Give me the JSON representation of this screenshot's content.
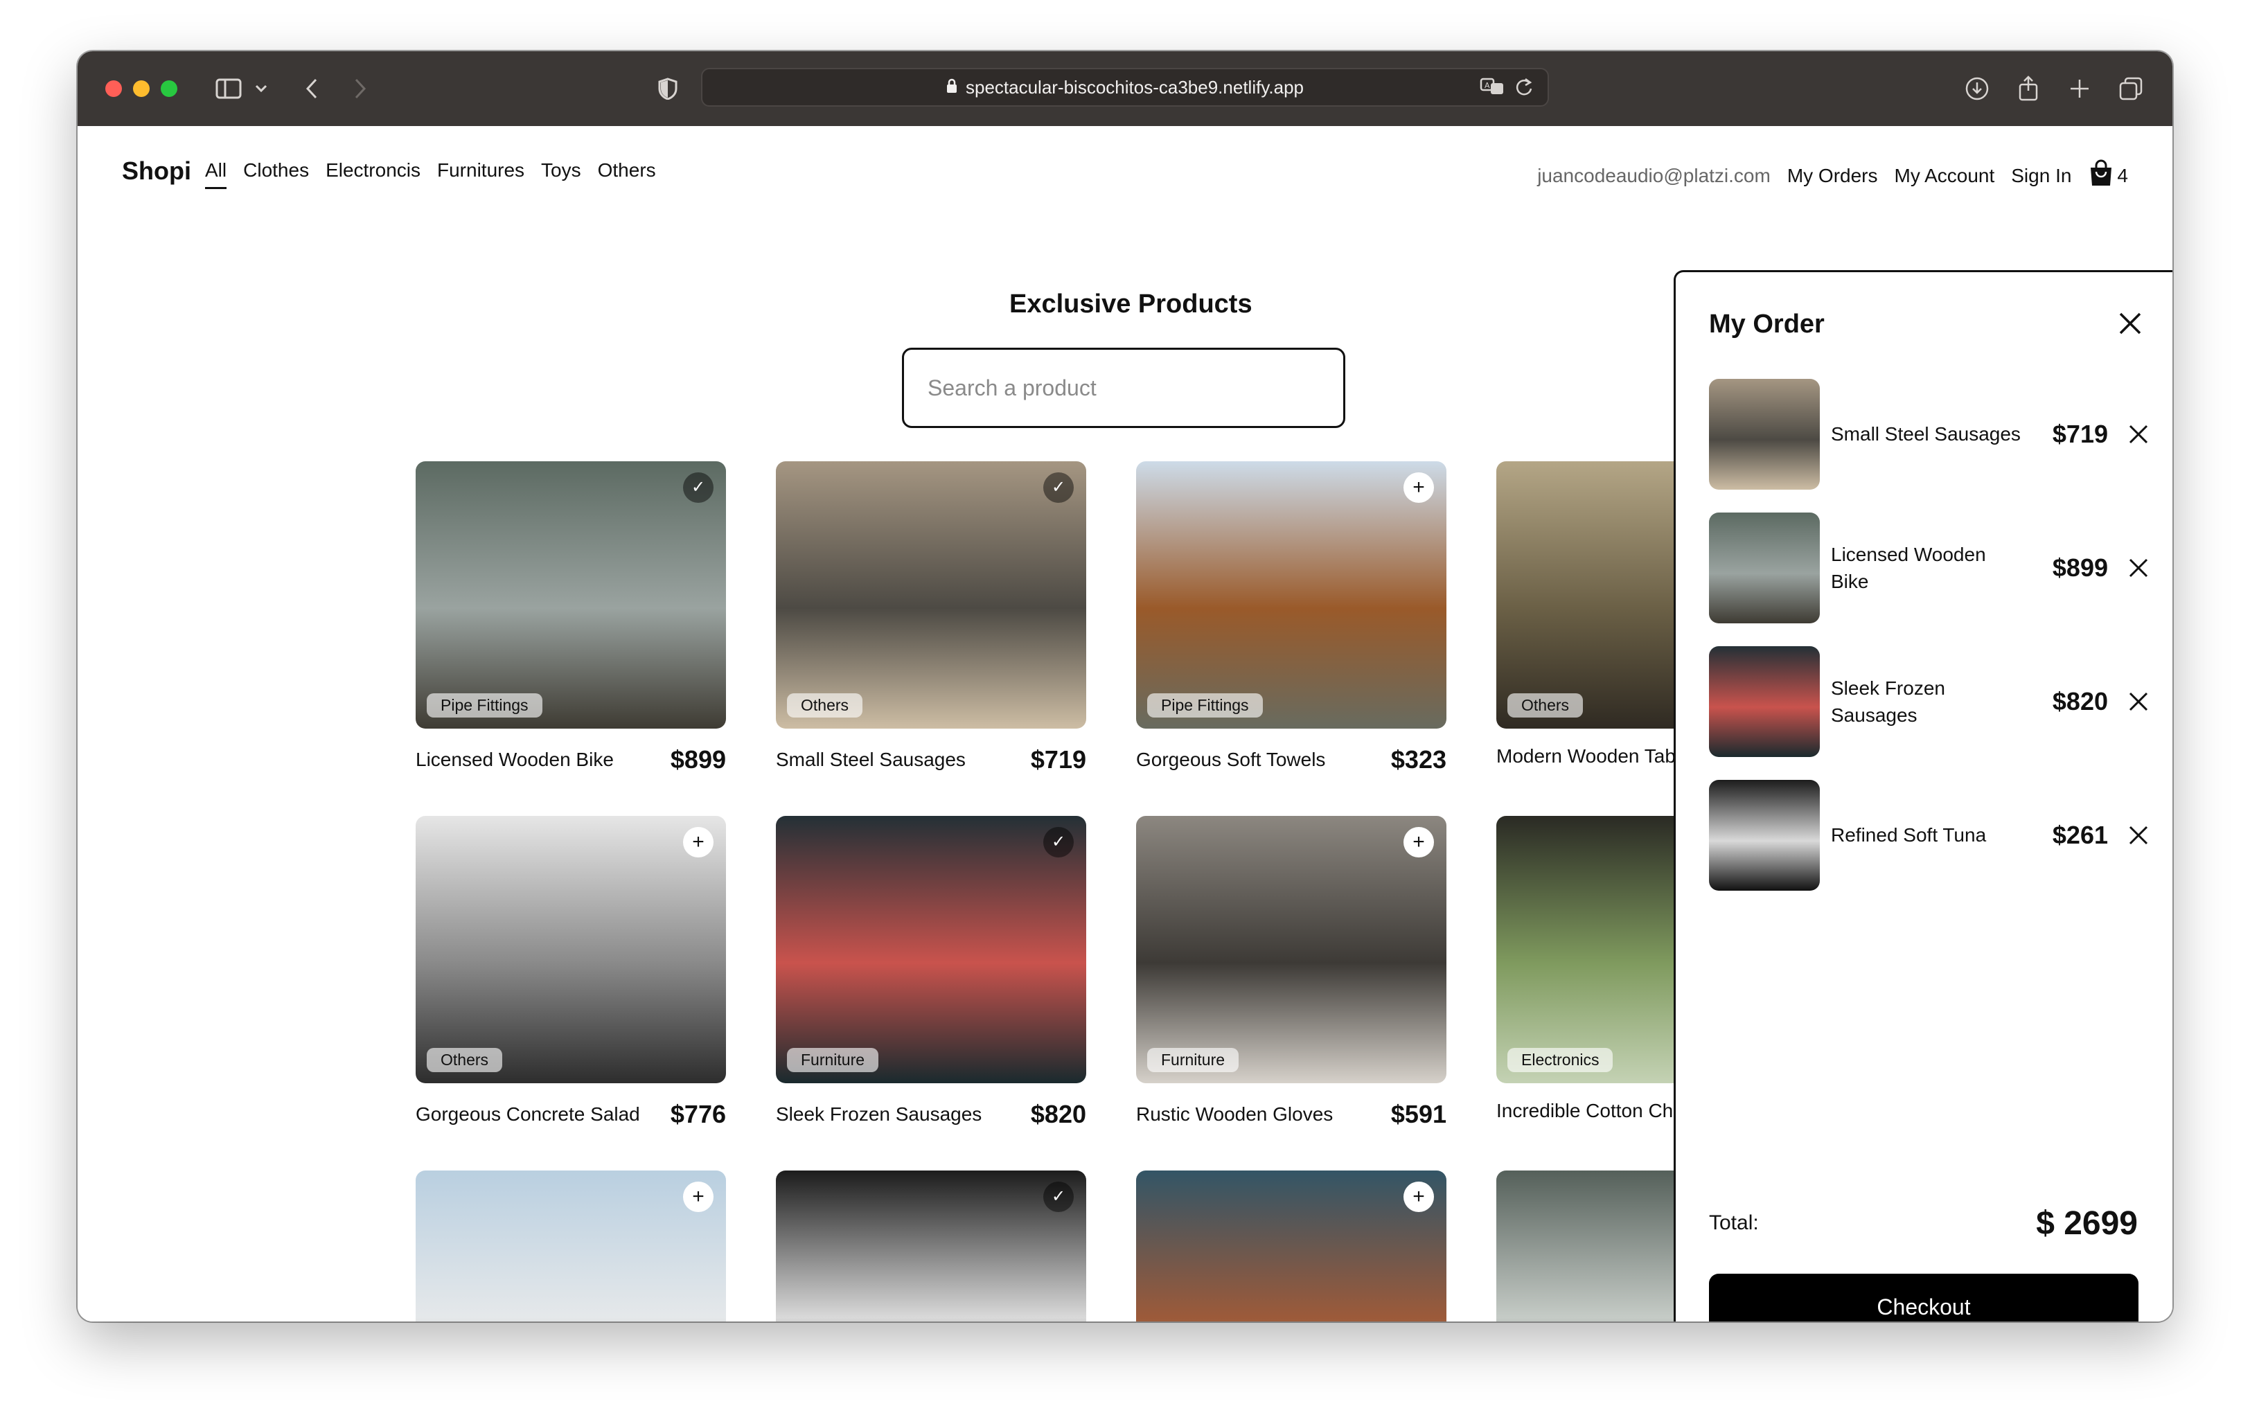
{
  "browser": {
    "url": "spectacular-biscochitos-ca3be9.netlify.app"
  },
  "nav": {
    "brand": "Shopi",
    "categories": [
      "All",
      "Clothes",
      "Electroncis",
      "Furnitures",
      "Toys",
      "Others"
    ],
    "active_category": "All",
    "email": "juancodeaudio@platzi.com",
    "my_orders": "My Orders",
    "my_account": "My Account",
    "sign_in": "Sign In",
    "cart_count": "4"
  },
  "main": {
    "heading": "Exclusive Products",
    "search_placeholder": "Search a product"
  },
  "products": [
    {
      "name": "Licensed Wooden Bike",
      "price": "$899",
      "category": "Pipe Fittings",
      "in_cart": true,
      "palette": [
        "#5c6a62",
        "#9aa3a0",
        "#3e3b33"
      ]
    },
    {
      "name": "Small Steel Sausages",
      "price": "$719",
      "category": "Others",
      "in_cart": true,
      "palette": [
        "#a59682",
        "#4d4a44",
        "#cdbda4"
      ]
    },
    {
      "name": "Gorgeous Soft Towels",
      "price": "$323",
      "category": "Pipe Fittings",
      "in_cart": false,
      "palette": [
        "#cddbe8",
        "#9a5a2a",
        "#686b5f"
      ]
    },
    {
      "name": "Modern Wooden Table",
      "price": "",
      "category": "Others",
      "in_cart": false,
      "palette": [
        "#b4a686",
        "#6b6046",
        "#2f2a22"
      ]
    },
    {
      "name": "Gorgeous Concrete Salad",
      "price": "$776",
      "category": "Others",
      "in_cart": false,
      "palette": [
        "#e6e6e6",
        "#8a8a8a",
        "#2d2d2d"
      ]
    },
    {
      "name": "Sleek Frozen Sausages",
      "price": "$820",
      "category": "Furniture",
      "in_cart": true,
      "palette": [
        "#243036",
        "#c9534d",
        "#1a2a2e"
      ]
    },
    {
      "name": "Rustic Wooden Gloves",
      "price": "$591",
      "category": "Furniture",
      "in_cart": false,
      "palette": [
        "#8c8780",
        "#3d3a36",
        "#d6d1ca"
      ]
    },
    {
      "name": "Incredible Cotton Chair",
      "price": "",
      "category": "Electronics",
      "in_cart": false,
      "palette": [
        "#2a2a24",
        "#7f9a5e",
        "#c4d2b4"
      ]
    },
    {
      "name": "",
      "price": "",
      "category": "",
      "in_cart": false,
      "palette": [
        "#b9cfe0",
        "#e5e8ea",
        "#6e6e64"
      ]
    },
    {
      "name": "",
      "price": "",
      "category": "",
      "in_cart": true,
      "palette": [
        "#1c1c1c",
        "#d9d9d9",
        "#111111"
      ]
    },
    {
      "name": "",
      "price": "",
      "category": "",
      "in_cart": false,
      "palette": [
        "#335566",
        "#9c5a3a",
        "#c9a36b"
      ]
    },
    {
      "name": "",
      "price": "",
      "category": "",
      "in_cart": false,
      "palette": [
        "#55605a",
        "#c5cbc6",
        "#2e3530"
      ]
    }
  ],
  "order": {
    "title": "My Order",
    "items": [
      {
        "name": "Small Steel Sausages",
        "price": "$719",
        "palette": [
          "#a59682",
          "#4d4a44",
          "#cdbda4"
        ]
      },
      {
        "name": "Licensed Wooden Bike",
        "price": "$899",
        "palette": [
          "#5c6a62",
          "#9aa3a0",
          "#3e3b33"
        ]
      },
      {
        "name": "Sleek Frozen Sausages",
        "price": "$820",
        "palette": [
          "#243036",
          "#c9534d",
          "#1a2a2e"
        ]
      },
      {
        "name": "Refined Soft Tuna",
        "price": "$261",
        "palette": [
          "#1c1c1c",
          "#d9d9d9",
          "#111111"
        ]
      }
    ],
    "total_label": "Total:",
    "total_value": "$ 2699",
    "checkout_label": "Checkout"
  }
}
